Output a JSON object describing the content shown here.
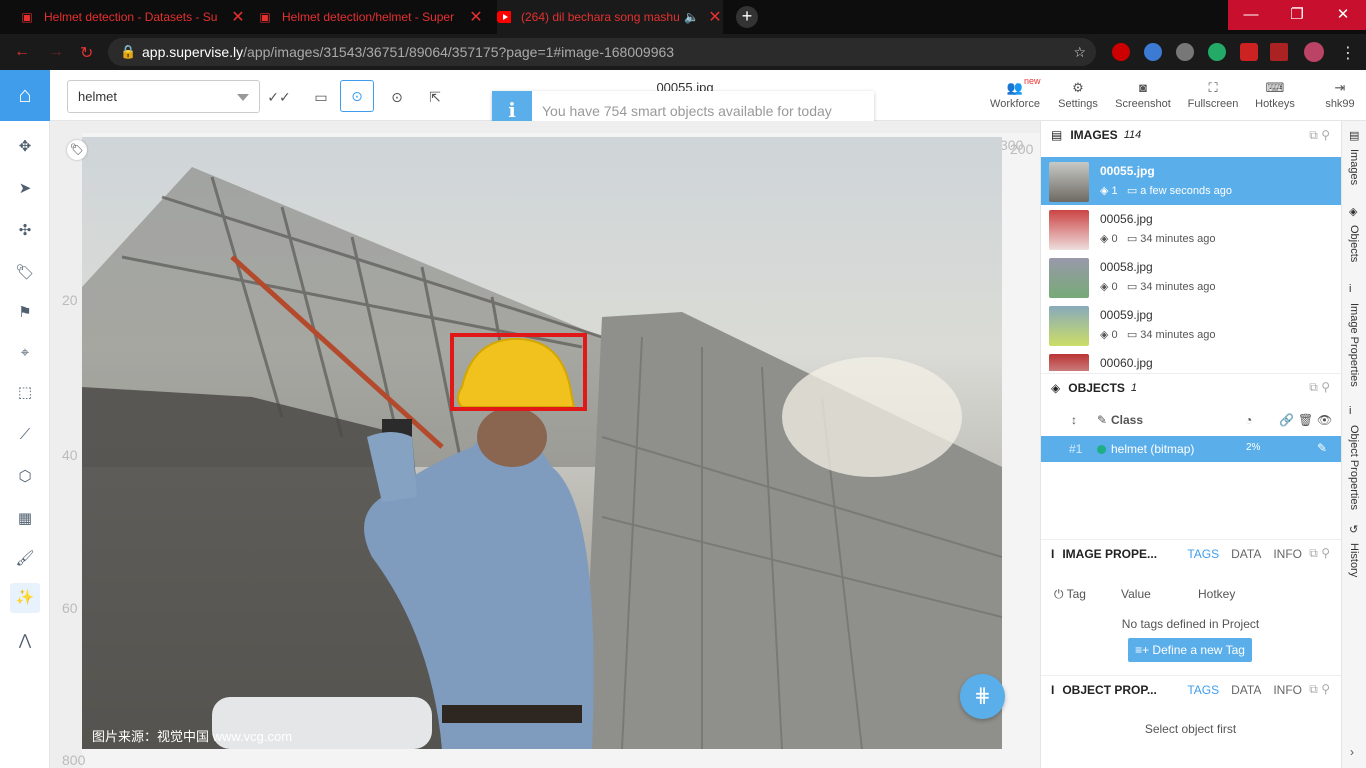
{
  "browser": {
    "tabs": [
      {
        "title": "Helmet detection - Datasets - Su",
        "icon": "supervisely-icon"
      },
      {
        "title": "Helmet detection/helmet - Super",
        "icon": "supervisely-icon"
      },
      {
        "title": "(264) dil bechara song mashu",
        "icon": "youtube-icon"
      }
    ],
    "url_host": "app.supervise.ly",
    "url_path": "/app/images/31543/36751/89064/357175?page=1#image-168009963",
    "window_controls": {
      "minimize": "—",
      "restore": "❐",
      "close": "✕"
    }
  },
  "toolbar": {
    "class_select": "helmet",
    "image_title": "00055.jpg",
    "notice_icon": "i",
    "notice_text": "You have 754 smart objects available for today",
    "new_badge": "new",
    "buttons": [
      {
        "label": "Workforce",
        "icon": "users-icon"
      },
      {
        "label": "Settings",
        "icon": "gear-icon"
      },
      {
        "label": "Screenshot",
        "icon": "camera-icon"
      },
      {
        "label": "Fullscreen",
        "icon": "fullscreen-icon"
      },
      {
        "label": "Hotkeys",
        "icon": "keyboard-icon"
      },
      {
        "label": "shk99",
        "icon": "logout-icon"
      }
    ]
  },
  "canvas": {
    "ruler_labels": [
      "20",
      "40",
      "60",
      "800",
      "300",
      "200"
    ],
    "watermark": "图片来源：视觉中国 www.vcg.com",
    "annotation_color": "#e01818"
  },
  "images_panel": {
    "title": "IMAGES",
    "count": "114",
    "items": [
      {
        "name": "00055.jpg",
        "objects": "1",
        "time": "a few seconds ago",
        "selected": true
      },
      {
        "name": "00056.jpg",
        "objects": "0",
        "time": "34 minutes ago",
        "selected": false
      },
      {
        "name": "00058.jpg",
        "objects": "0",
        "time": "34 minutes ago",
        "selected": false
      },
      {
        "name": "00059.jpg",
        "objects": "0",
        "time": "34 minutes ago",
        "selected": false
      },
      {
        "name": "00060.jpg",
        "objects": "",
        "time": "",
        "selected": false
      }
    ]
  },
  "objects_panel": {
    "title": "OBJECTS",
    "count": "1",
    "col_class": "Class",
    "rows": [
      {
        "index": "#1",
        "name": "helmet (bitmap)",
        "percent": "2%",
        "color": "#1fae84"
      }
    ]
  },
  "image_props_panel": {
    "title": "IMAGE PROPE...",
    "tabs": [
      "TAGS",
      "DATA",
      "INFO"
    ],
    "col_tag": "Tag",
    "col_value": "Value",
    "col_hotkey": "Hotkey",
    "empty_text": "No tags defined in Project",
    "define_button": "Define a new Tag"
  },
  "object_props_panel": {
    "title": "OBJECT PROP...",
    "tabs": [
      "TAGS",
      "DATA",
      "INFO"
    ],
    "empty_text": "Select object first"
  },
  "vertical_tabs": [
    "Images",
    "Objects",
    "Image Properties",
    "Object Properties",
    "History"
  ],
  "colors": {
    "accent": "#5aaeea",
    "home": "#3f9dec",
    "browser_bg": "#0d0d0d"
  }
}
